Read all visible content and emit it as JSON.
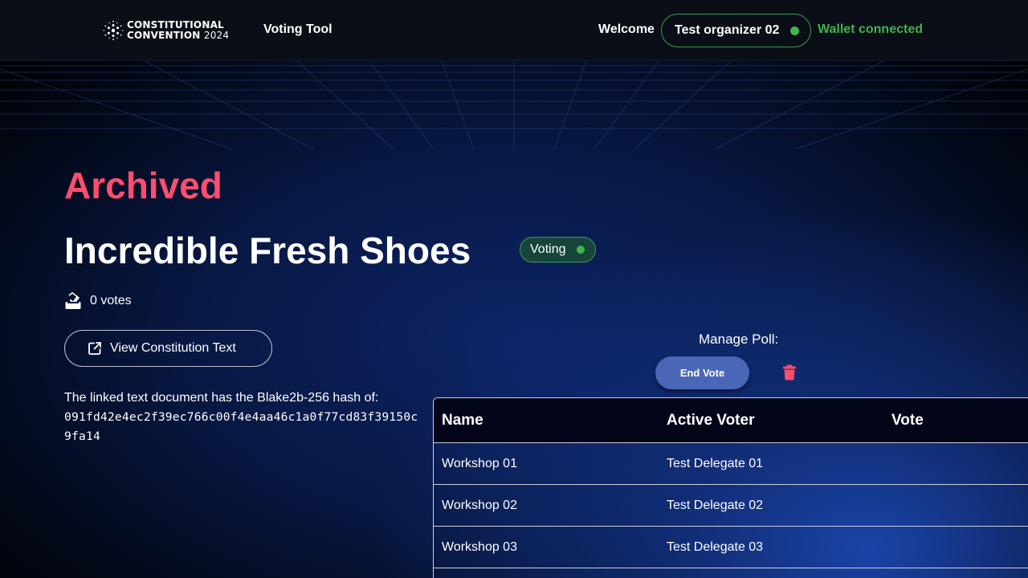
{
  "header": {
    "logo_line1": "CONSTITUTIONAL",
    "logo_line2": "CONVENTION",
    "logo_year": "2024",
    "tool_name": "Voting Tool",
    "welcome": "Welcome",
    "user_name": "Test organizer 02",
    "wallet_status": "Wallet connected"
  },
  "poll": {
    "archived_label": "Archived",
    "title": "Incredible Fresh Shoes",
    "status": "Voting",
    "votes_text": "0 votes",
    "view_button": "View Constitution Text",
    "hash_intro": "The linked text document has the Blake2b-256 hash of:",
    "hash_line1": "091fd42e4ec2f39ec766c00f4e4aa46c1a0f77cd83f39150c",
    "hash_line2": "9fa14"
  },
  "manage": {
    "label": "Manage Poll:",
    "end_vote": "End Vote"
  },
  "table": {
    "headers": [
      "Name",
      "Active Voter",
      "Vote"
    ],
    "rows": [
      {
        "name": "Workshop 01",
        "voter": "Test Delegate 01",
        "vote": ""
      },
      {
        "name": "Workshop 02",
        "voter": "Test Delegate 02",
        "vote": ""
      },
      {
        "name": "Workshop 03",
        "voter": "Test Delegate 03",
        "vote": ""
      }
    ]
  },
  "colors": {
    "archived": "#ff4d6d",
    "connected_green": "#3fb34f",
    "end_vote_button": "#4a66b7",
    "trash": "#ff4d6d"
  },
  "icons": {
    "logo": "cardano-logo-icon",
    "votes": "ballot-box-icon",
    "view": "external-link-icon",
    "delete": "trash-icon"
  }
}
